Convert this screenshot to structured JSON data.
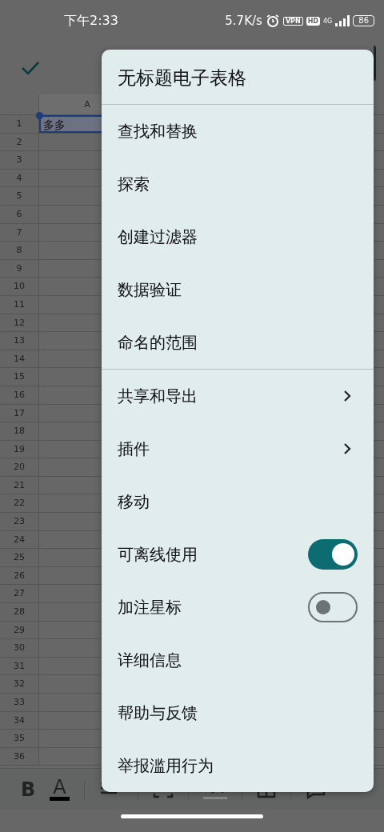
{
  "status_bar": {
    "time": "下午2:33",
    "net_speed": "5.7K/s",
    "vpn": "VPN",
    "hd": "HD",
    "network": "4G",
    "battery": "86"
  },
  "sheet": {
    "column_header": "A",
    "rows": [
      {
        "number": "1",
        "cell": "多多",
        "selected": true
      },
      {
        "number": "2"
      },
      {
        "number": "3"
      },
      {
        "number": "4"
      },
      {
        "number": "5"
      },
      {
        "number": "6"
      },
      {
        "number": "7"
      },
      {
        "number": "8"
      },
      {
        "number": "9"
      },
      {
        "number": "10"
      },
      {
        "number": "11"
      },
      {
        "number": "12"
      },
      {
        "number": "13"
      },
      {
        "number": "14"
      },
      {
        "number": "15"
      },
      {
        "number": "16"
      },
      {
        "number": "17"
      },
      {
        "number": "18"
      },
      {
        "number": "19"
      },
      {
        "number": "20"
      },
      {
        "number": "21"
      },
      {
        "number": "22"
      },
      {
        "number": "23"
      },
      {
        "number": "24"
      },
      {
        "number": "25"
      },
      {
        "number": "26"
      },
      {
        "number": "27"
      },
      {
        "number": "28"
      },
      {
        "number": "29"
      },
      {
        "number": "30"
      },
      {
        "number": "31"
      },
      {
        "number": "32"
      },
      {
        "number": "33"
      },
      {
        "number": "34"
      },
      {
        "number": "35"
      },
      {
        "number": "36"
      }
    ]
  },
  "toolbar": {
    "bold": "B",
    "text_color": "A"
  },
  "menu": {
    "title": "无标题电子表格",
    "sections": [
      {
        "items": [
          {
            "label": "查找和替换",
            "kind": "plain"
          },
          {
            "label": "探索",
            "kind": "plain"
          },
          {
            "label": "创建过滤器",
            "kind": "plain"
          },
          {
            "label": "数据验证",
            "kind": "plain"
          },
          {
            "label": "命名的范围",
            "kind": "plain"
          }
        ]
      },
      {
        "items": [
          {
            "label": "共享和导出",
            "kind": "submenu"
          },
          {
            "label": "插件",
            "kind": "submenu"
          },
          {
            "label": "移动",
            "kind": "plain"
          },
          {
            "label": "可离线使用",
            "kind": "toggle",
            "on": true
          },
          {
            "label": "加注星标",
            "kind": "toggle",
            "on": false
          },
          {
            "label": "详细信息",
            "kind": "plain"
          },
          {
            "label": "帮助与反馈",
            "kind": "plain"
          },
          {
            "label": "举报滥用行为",
            "kind": "plain"
          }
        ]
      }
    ]
  }
}
